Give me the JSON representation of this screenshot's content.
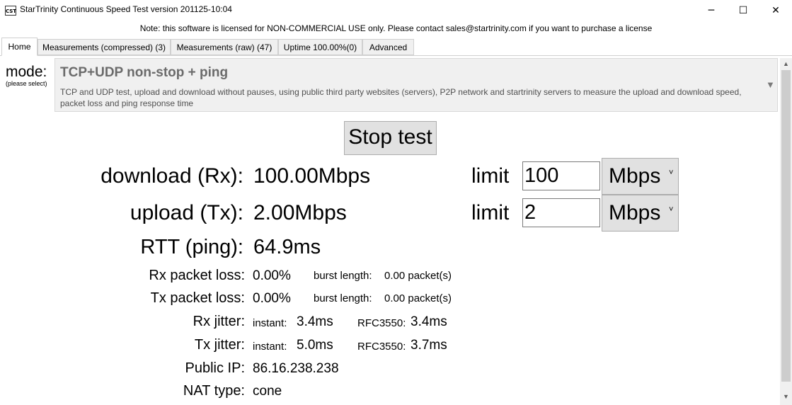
{
  "window": {
    "icon_text": "CST",
    "title": "StarTrinity Continuous Speed Test version 201125-10:04",
    "minimize": "─",
    "maximize": "☐",
    "close": "✕"
  },
  "notice": "Note: this software is licensed for NON-COMMERCIAL USE only. Please contact sales@startrinity.com if you want to purchase a license",
  "tabs": [
    {
      "label": "Home",
      "active": true
    },
    {
      "label": "Measurements (compressed)  (3)",
      "active": false
    },
    {
      "label": "Measurements (raw)  (47)",
      "active": false
    },
    {
      "label": "Uptime  100.00%(0)",
      "active": false
    },
    {
      "label": "Advanced",
      "active": false
    }
  ],
  "mode": {
    "label": "mode:",
    "sublabel": "(please select)",
    "selected_title": "TCP+UDP non-stop + ping",
    "selected_description": "TCP and UDP test, upload and download without pauses, using public third party websites (servers), P2P network and startrinity servers to measure the upload and download speed, packet loss and ping response time",
    "arrow": "▼"
  },
  "stop_button": "Stop test",
  "download": {
    "label": "download (Rx):",
    "value": "100.00Mbps",
    "limit_label": "limit",
    "limit_value": "100",
    "unit": "Mbps"
  },
  "upload": {
    "label": "upload (Tx):",
    "value": "2.00Mbps",
    "limit_label": "limit",
    "limit_value": "2",
    "unit": "Mbps"
  },
  "rtt": {
    "label": "RTT (ping):",
    "value": "64.9ms"
  },
  "rx_loss": {
    "label": "Rx packet loss:",
    "value": "0.00%",
    "burst_label": "burst length:",
    "burst_value": "0.00 packet(s)"
  },
  "tx_loss": {
    "label": "Tx packet loss:",
    "value": "0.00%",
    "burst_label": "burst length:",
    "burst_value": "0.00 packet(s)"
  },
  "rx_jitter": {
    "label": "Rx jitter:",
    "instant_label": "instant:",
    "instant_value": "3.4ms",
    "rfc_label": "RFC3550:",
    "rfc_value": "3.4ms"
  },
  "tx_jitter": {
    "label": "Tx jitter:",
    "instant_label": "instant:",
    "instant_value": "5.0ms",
    "rfc_label": "RFC3550:",
    "rfc_value": "3.7ms"
  },
  "public_ip": {
    "label": "Public IP:",
    "value": "86.16.238.238"
  },
  "nat_type": {
    "label": "NAT type:",
    "value": "cone"
  },
  "scroll": {
    "up": "▲",
    "down": "▼"
  },
  "unit_chevron": "˅"
}
